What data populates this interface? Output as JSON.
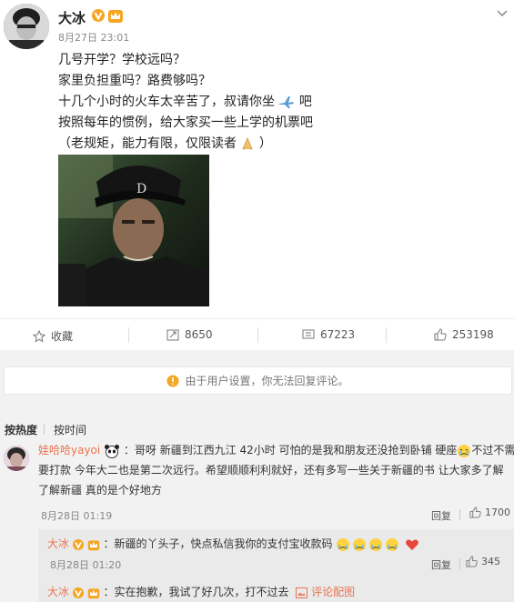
{
  "post": {
    "author": "大冰",
    "time": "8月27日 23:01",
    "lines": [
      "几号开学？学校远吗？",
      "家里负担重吗？路费够吗？",
      "十几个小时的火车太辛苦了，叔请你坐",
      "吧",
      "按照每年的惯例，给大家买一些上学的机票吧",
      "（老规矩，能力有限，仅限读者",
      "）"
    ]
  },
  "actions": {
    "favorite": "收藏",
    "repost_count": "8650",
    "comment_count": "67223",
    "like_count": "253198"
  },
  "notice": "由于用户设置，你无法回复评论。",
  "sort": {
    "hot": "按热度",
    "time": "按时间"
  },
  "comment": {
    "user": "娃哈哈yayoi",
    "line1": "：哥呀 新疆到江西九江 42小时 可怕的是我和朋友还没抢到卧铺 硬座",
    "line1_tail": "不过不需",
    "line2": "要打款 今年大二也是第二次远行。希望顺顺利利就好，还有多写一些关于新疆的书 让大家多了解",
    "line3": "了解新疆 真的是个好地方",
    "time": "8月28日 01:19",
    "reply_label": "回复",
    "likes": "1700"
  },
  "replies": [
    {
      "user": "大冰",
      "text": "：新疆的丫头子，快点私信我你的支付宝收款码",
      "time": "8月28日 01:20",
      "reply_label": "回复",
      "likes": "345"
    },
    {
      "user": "大冰",
      "text": "：实在抱歉，我试了好几次，打不过去",
      "more": "评论配图"
    }
  ],
  "colors": {
    "accent": "#eb7350",
    "verified": "#f5a623",
    "background": "#f2f2f2"
  }
}
